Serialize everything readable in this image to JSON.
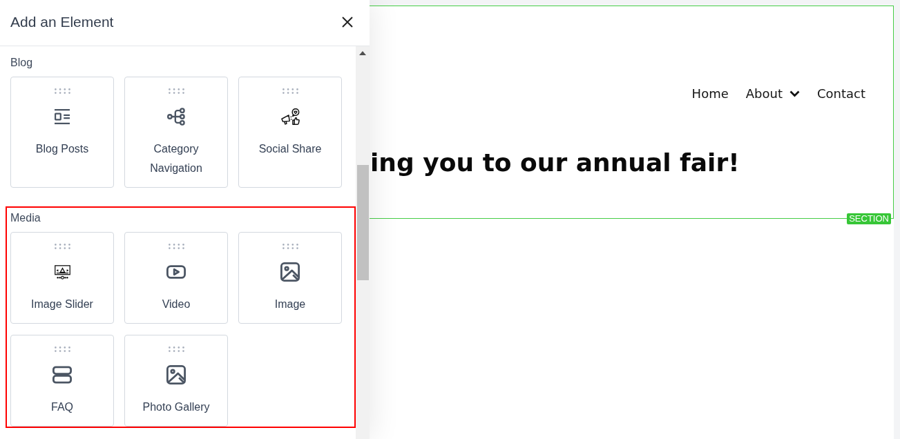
{
  "panel": {
    "title": "Add an Element",
    "sections": [
      {
        "title": "Blog",
        "highlighted": false,
        "elements": [
          {
            "kind": "posts",
            "label": "Blog Posts"
          },
          {
            "kind": "navigation",
            "label": "Category Navigation"
          },
          {
            "kind": "share",
            "label": "Social Share"
          }
        ]
      },
      {
        "title": "Media",
        "highlighted": true,
        "elements": [
          {
            "kind": "slider",
            "label": "Image Slider"
          },
          {
            "kind": "video",
            "label": "Video"
          },
          {
            "kind": "image",
            "label": "Image"
          },
          {
            "kind": "faq",
            "label": "FAQ"
          },
          {
            "kind": "gallery",
            "label": "Photo Gallery"
          }
        ]
      }
    ]
  },
  "canvas": {
    "nav": [
      {
        "label": "Home",
        "dropdown": false
      },
      {
        "label": "About",
        "dropdown": true
      },
      {
        "label": "Contact",
        "dropdown": false
      }
    ],
    "heading": "ing you to our annual fair!",
    "section_badge": "SECTION"
  }
}
